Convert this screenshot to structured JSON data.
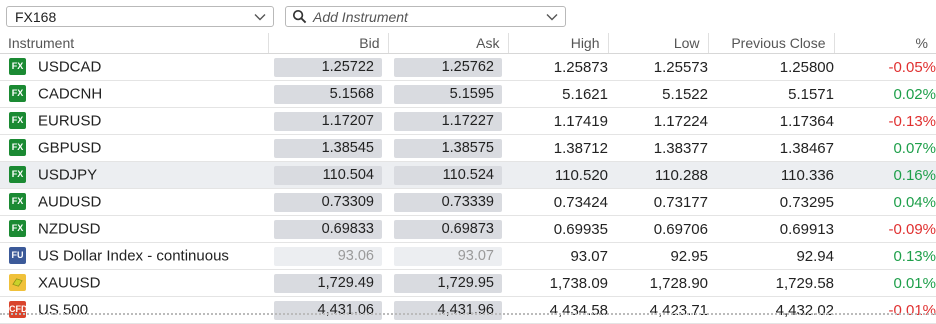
{
  "toolbar": {
    "list_name": "FX168",
    "add_placeholder": "Add Instrument"
  },
  "columns": {
    "instrument": "Instrument",
    "bid": "Bid",
    "ask": "Ask",
    "high": "High",
    "low": "Low",
    "prev_close": "Previous Close",
    "pct": "%"
  },
  "rows": [
    {
      "badge": "FX",
      "name": "USDCAD",
      "bid": "1.25722",
      "ask": "1.25762",
      "high": "1.25873",
      "low": "1.25573",
      "prev": "1.25800",
      "pct": "-0.05%",
      "dir": "neg"
    },
    {
      "badge": "FX",
      "name": "CADCNH",
      "bid": "5.1568",
      "ask": "5.1595",
      "high": "5.1621",
      "low": "5.1522",
      "prev": "5.1571",
      "pct": "0.02%",
      "dir": "pos"
    },
    {
      "badge": "FX",
      "name": "EURUSD",
      "bid": "1.17207",
      "ask": "1.17227",
      "high": "1.17419",
      "low": "1.17224",
      "prev": "1.17364",
      "pct": "-0.13%",
      "dir": "neg"
    },
    {
      "badge": "FX",
      "name": "GBPUSD",
      "bid": "1.38545",
      "ask": "1.38575",
      "high": "1.38712",
      "low": "1.38377",
      "prev": "1.38467",
      "pct": "0.07%",
      "dir": "pos"
    },
    {
      "badge": "FX",
      "name": "USDJPY",
      "bid": "110.504",
      "ask": "110.524",
      "high": "110.520",
      "low": "110.288",
      "prev": "110.336",
      "pct": "0.16%",
      "dir": "pos",
      "highlight": true
    },
    {
      "badge": "FX",
      "name": "AUDUSD",
      "bid": "0.73309",
      "ask": "0.73339",
      "high": "0.73424",
      "low": "0.73177",
      "prev": "0.73295",
      "pct": "0.04%",
      "dir": "pos"
    },
    {
      "badge": "FX",
      "name": "NZDUSD",
      "bid": "0.69833",
      "ask": "0.69873",
      "high": "0.69935",
      "low": "0.69706",
      "prev": "0.69913",
      "pct": "-0.09%",
      "dir": "neg"
    },
    {
      "badge": "FU",
      "name": "US Dollar Index - continuous",
      "bid": "93.06",
      "ask": "93.07",
      "high": "93.07",
      "low": "92.95",
      "prev": "92.94",
      "pct": "0.13%",
      "dir": "pos",
      "dim": true
    },
    {
      "badge": "GOLD",
      "name": "XAUUSD",
      "bid": "1,729.49",
      "ask": "1,729.95",
      "high": "1,738.09",
      "low": "1,728.90",
      "prev": "1,729.58",
      "pct": "0.01%",
      "dir": "pos"
    },
    {
      "badge": "CFD",
      "name": "US 500",
      "bid": "4,431.06",
      "ask": "4,431.96",
      "high": "4,434.58",
      "low": "4,423.71",
      "prev": "4,432.02",
      "pct": "-0.01%",
      "dir": "neg"
    }
  ],
  "colors": {
    "negative": "#e03030",
    "positive": "#1e9f4a",
    "fx_badge": "#1b8a33",
    "highlight_row": "#eceef1"
  }
}
